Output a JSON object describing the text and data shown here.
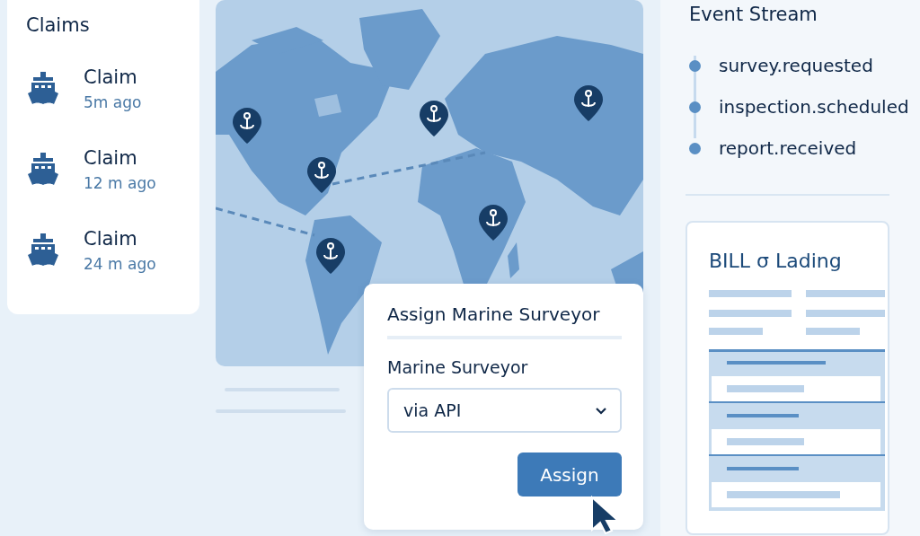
{
  "claims": {
    "title": "Claims",
    "items": [
      {
        "title": "Claim",
        "time": "5m ago"
      },
      {
        "title": "Claim",
        "time": "12 m ago"
      },
      {
        "title": "Claim",
        "time": "24 m ago"
      }
    ]
  },
  "dialog": {
    "title": "Assign Marine Surveyor",
    "field_label": "Marine Surveyor",
    "select": {
      "value": "via API"
    },
    "button": "Assign"
  },
  "event_stream": {
    "title": "Event Stream",
    "events": [
      "survey.requested",
      "inspection.scheduled",
      "report.received"
    ]
  },
  "document": {
    "title": "BILL σ Lading"
  }
}
